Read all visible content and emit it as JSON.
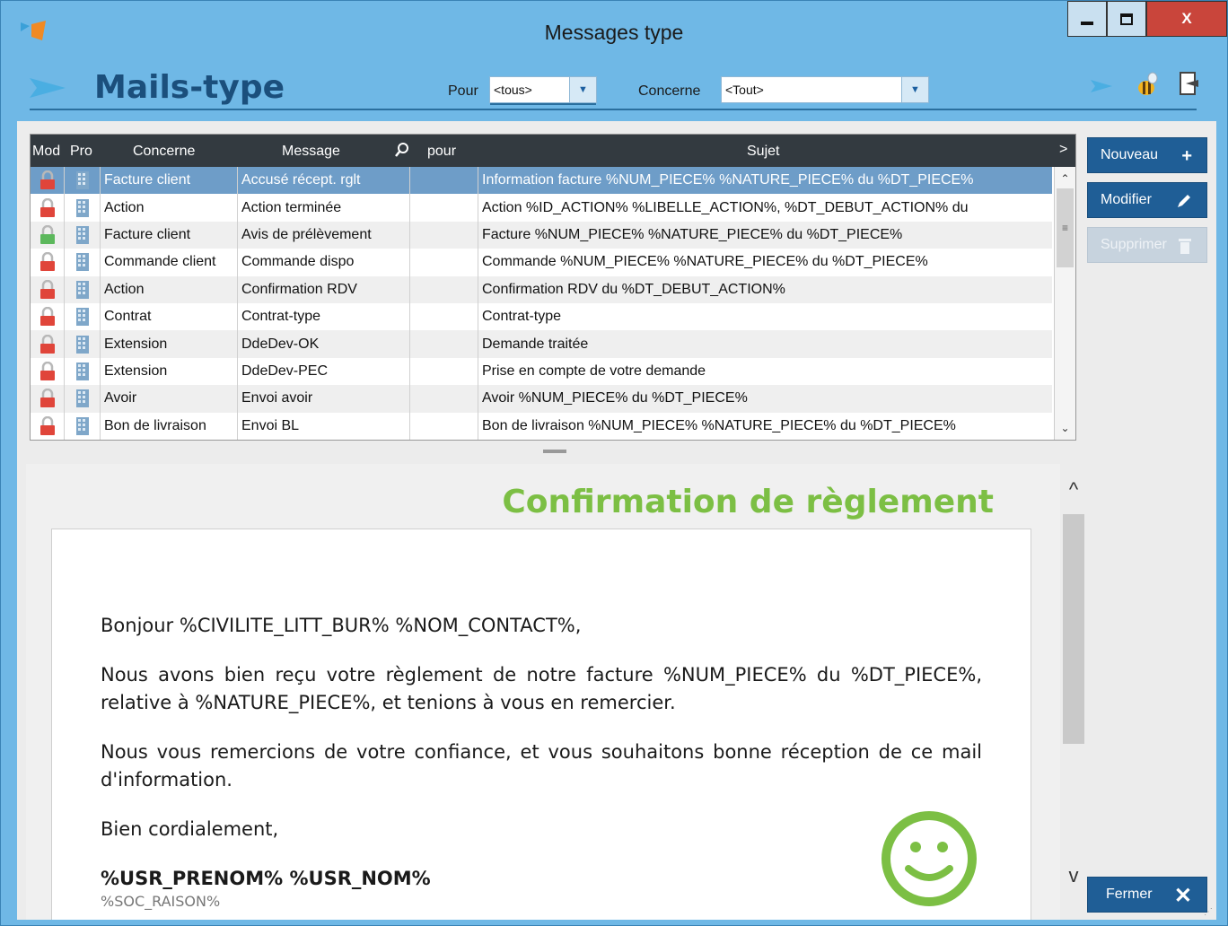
{
  "window": {
    "title": "Messages type",
    "close_label": "X"
  },
  "header": {
    "title": "Mails-type",
    "pour_label": "Pour",
    "pour_value": "<tous>",
    "concerne_label": "Concerne",
    "concerne_value": "<Tout>"
  },
  "table": {
    "columns": {
      "mod": "Mod",
      "pro": "Pro",
      "concerne": "Concerne",
      "message": "Message",
      "pour": "pour",
      "sujet": "Sujet"
    },
    "rows": [
      {
        "concerne": "Facture client",
        "message": "Accusé récept. rglt",
        "pour": "",
        "sujet": "Information facture %NUM_PIECE% %NATURE_PIECE% du %DT_PIECE%",
        "lock": "red",
        "selected": true
      },
      {
        "concerne": "Action",
        "message": "Action terminée",
        "pour": "",
        "sujet": "Action %ID_ACTION% %LIBELLE_ACTION%, %DT_DEBUT_ACTION% du",
        "lock": "red"
      },
      {
        "concerne": "Facture client",
        "message": "Avis de prélèvement",
        "pour": "",
        "sujet": "Facture %NUM_PIECE% %NATURE_PIECE% du %DT_PIECE%",
        "lock": "green"
      },
      {
        "concerne": "Commande client",
        "message": "Commande dispo",
        "pour": "",
        "sujet": "Commande %NUM_PIECE% %NATURE_PIECE% du %DT_PIECE%",
        "lock": "red"
      },
      {
        "concerne": "Action",
        "message": "Confirmation RDV",
        "pour": "",
        "sujet": "Confirmation RDV du  %DT_DEBUT_ACTION%",
        "lock": "red"
      },
      {
        "concerne": "Contrat",
        "message": "Contrat-type",
        "pour": "",
        "sujet": "Contrat-type",
        "lock": "red"
      },
      {
        "concerne": "Extension",
        "message": "DdeDev-OK",
        "pour": "",
        "sujet": "Demande traitée",
        "lock": "red"
      },
      {
        "concerne": "Extension",
        "message": "DdeDev-PEC",
        "pour": "",
        "sujet": "Prise en compte de votre demande",
        "lock": "red"
      },
      {
        "concerne": "Avoir",
        "message": "Envoi avoir",
        "pour": "",
        "sujet": "Avoir %NUM_PIECE% du  %DT_PIECE%",
        "lock": "red"
      },
      {
        "concerne": "Bon de livraison",
        "message": "Envoi BL",
        "pour": "",
        "sujet": "Bon de livraison %NUM_PIECE% %NATURE_PIECE% du %DT_PIECE%",
        "lock": "red"
      }
    ]
  },
  "actions": {
    "nouveau": "Nouveau",
    "modifier": "Modifier",
    "supprimer": "Supprimer",
    "fermer": "Fermer"
  },
  "preview": {
    "title": "Confirmation de règlement",
    "greeting": "Bonjour %CIVILITE_LITT_BUR% %NOM_CONTACT%,",
    "para1": "Nous avons bien reçu votre règlement de notre facture %NUM_PIECE% du %DT_PIECE%, relative à %NATURE_PIECE%, et tenions à vous en remercier.",
    "para2": "Nous vous remercions de votre confiance, et vous souhaitons bonne réception de ce mail d'information.",
    "closing": "Bien cordialement,",
    "signature": "%USR_PRENOM% %USR_NOM%",
    "cut_line": "%SOC_RAISON%"
  },
  "colors": {
    "accent": "#1f5e96",
    "title_green": "#7cbf44",
    "selected_row": "#6e9dc8",
    "lock_red": "#e0453a",
    "lock_green": "#5cb85c"
  }
}
